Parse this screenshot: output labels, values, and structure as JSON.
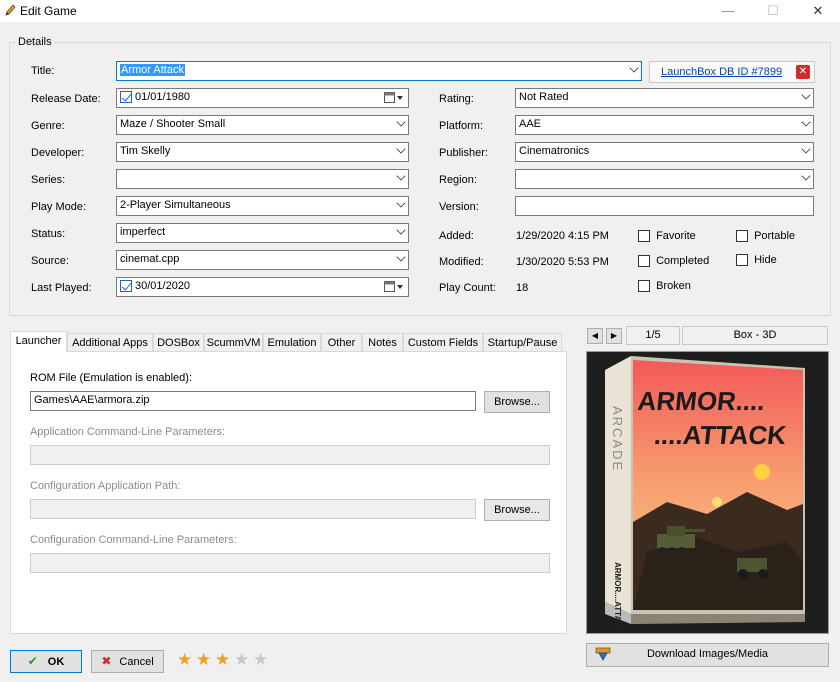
{
  "window": {
    "title": "Edit Game",
    "minimize": "—",
    "maximize": "☐",
    "close": "✕"
  },
  "details": {
    "group_label": "Details",
    "title_label": "Title:",
    "title_value": "Armor Attack",
    "launchbox_link": "LaunchBox DB ID #7899",
    "release_date_label": "Release Date:",
    "release_date_value": "01/01/1980",
    "genre_label": "Genre:",
    "genre_value": "Maze / Shooter Small",
    "developer_label": "Developer:",
    "developer_value": "Tim Skelly",
    "series_label": "Series:",
    "series_value": "",
    "play_mode_label": "Play Mode:",
    "play_mode_value": "2-Player Simultaneous",
    "status_label": "Status:",
    "status_value": "imperfect",
    "source_label": "Source:",
    "source_value": "cinemat.cpp",
    "last_played_label": "Last Played:",
    "last_played_value": "30/01/2020",
    "rating_label": "Rating:",
    "rating_value": "Not Rated",
    "platform_label": "Platform:",
    "platform_value": "AAE",
    "publisher_label": "Publisher:",
    "publisher_value": "Cinematronics",
    "region_label": "Region:",
    "region_value": "",
    "version_label": "Version:",
    "version_value": "",
    "added_label": "Added:",
    "added_value": "1/29/2020 4:15 PM",
    "modified_label": "Modified:",
    "modified_value": "1/30/2020 5:53 PM",
    "play_count_label": "Play Count:",
    "play_count_value": "18",
    "checkboxes": {
      "favorite": "Favorite",
      "completed": "Completed",
      "broken": "Broken",
      "portable": "Portable",
      "hide": "Hide"
    }
  },
  "tabs": [
    "Launcher",
    "Additional Apps",
    "DOSBox",
    "ScummVM",
    "Emulation",
    "Other",
    "Notes",
    "Custom Fields",
    "Startup/Pause"
  ],
  "launcher": {
    "rom_file_label": "ROM File (Emulation is enabled):",
    "rom_file_value": "Games\\AAE\\armora.zip",
    "browse_label": "Browse...",
    "app_cmd_label": "Application Command-Line Parameters:",
    "config_path_label": "Configuration Application Path:",
    "config_browse_label": "Browse...",
    "config_cmd_label": "Configuration Command-Line Parameters:"
  },
  "image_panel": {
    "counter": "1/5",
    "image_type": "Box - 3D",
    "box_art": {
      "side_text": "ARCADE",
      "line1": "ARMOR....",
      "line2": "....ATTACK",
      "spine_text": "ARMOR....ATTACK"
    },
    "download_label": "Download Images/Media"
  },
  "footer": {
    "ok_label": "OK",
    "cancel_label": "Cancel",
    "rating_stars": 3,
    "rating_max": 5
  },
  "colors": {
    "accent": "#0078d7",
    "selection": "#3399ff",
    "link": "#0645ad",
    "star_on": "#f0a020",
    "star_off": "#c8c8c8"
  }
}
